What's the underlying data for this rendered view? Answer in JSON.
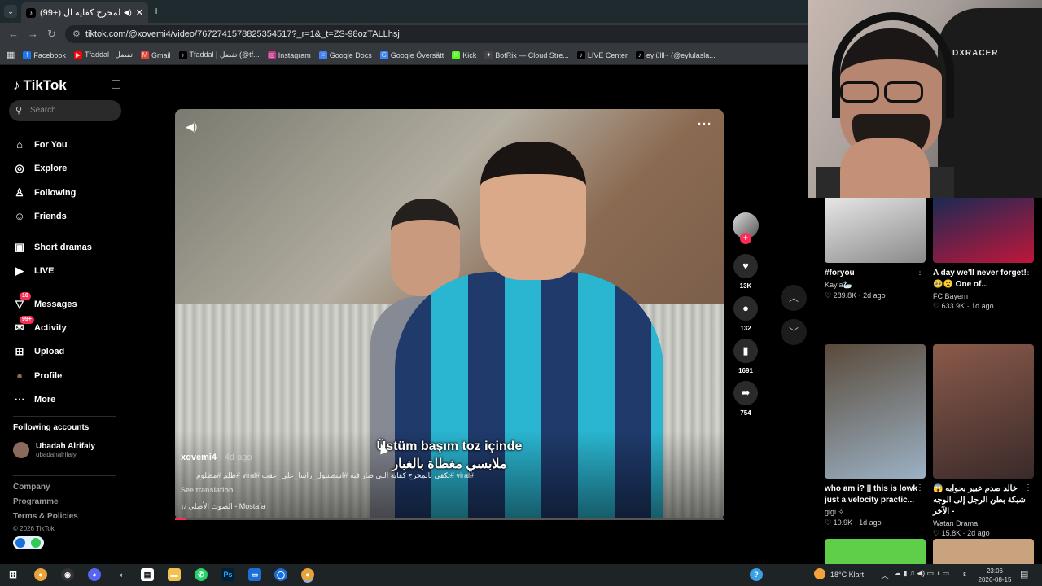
{
  "browser": {
    "tab_title": "(99+) تكفى بالمخرج كفايه ال...",
    "url_scheme_icon": "site-info-icon",
    "url": "tiktok.com/@xovemi4/video/7672741578825354517?_r=1&_t=ZS-98ozTALLhsj",
    "bookmarks": [
      {
        "label": "Facebook",
        "color": "#1877f2",
        "glyph": "f"
      },
      {
        "label": "Tfaddal | تفضل",
        "color": "#ff0000",
        "glyph": "▶"
      },
      {
        "label": "Gmail",
        "color": "#ea4335",
        "glyph": "M"
      },
      {
        "label": "Tfaddal | تفضل (@tf...",
        "color": "#000000",
        "glyph": "♪"
      },
      {
        "label": "Instagram",
        "color": "#c13584",
        "glyph": "◎"
      },
      {
        "label": "Google Docs",
        "color": "#4285f4",
        "glyph": "≡"
      },
      {
        "label": "Google Översätt",
        "color": "#4285f4",
        "glyph": "G"
      },
      {
        "label": "Kick",
        "color": "#53fc18",
        "glyph": "K"
      },
      {
        "label": "BotRix — Cloud Stre...",
        "color": "#444444",
        "glyph": "✦"
      },
      {
        "label": "LIVE Center",
        "color": "#000000",
        "glyph": "♪"
      },
      {
        "label": "eylülll~ (@eylulasla...",
        "color": "#000000",
        "glyph": "♪"
      }
    ]
  },
  "sidebar": {
    "logo": "TikTok",
    "search_placeholder": "Search",
    "items": [
      {
        "label": "For You",
        "icon": "home-icon",
        "glyph": "⌂"
      },
      {
        "label": "Explore",
        "icon": "compass-icon",
        "glyph": "◎"
      },
      {
        "label": "Following",
        "icon": "following-icon",
        "glyph": "♙"
      },
      {
        "label": "Friends",
        "icon": "friends-icon",
        "glyph": "☺"
      },
      {
        "label": "Short dramas",
        "icon": "dramas-icon",
        "glyph": "▣"
      },
      {
        "label": "LIVE",
        "icon": "live-icon",
        "glyph": "▶"
      },
      {
        "label": "Messages",
        "icon": "messages-icon",
        "glyph": "▽",
        "badge": "10"
      },
      {
        "label": "Activity",
        "icon": "activity-icon",
        "glyph": "✉",
        "badge": "99+"
      },
      {
        "label": "Upload",
        "icon": "upload-icon",
        "glyph": "⊞"
      },
      {
        "label": "Profile",
        "icon": "profile-avatar-icon",
        "glyph": "●"
      },
      {
        "label": "More",
        "icon": "more-icon",
        "glyph": "⋯"
      }
    ],
    "following_accounts_title": "Following accounts",
    "following_account": {
      "name": "Ubadah Alrifaiy",
      "handle": "ubadahalrifaiy"
    },
    "footer": [
      "Company",
      "Programme",
      "Terms & Policies"
    ],
    "copyright": "© 2026 TikTok"
  },
  "video": {
    "author": "xovemi4",
    "age": "· 4d ago",
    "caption": "#viral #تكفى بالمخرج كفايه اللي صار فيه #اسطنبول_راسا_على_عقب #viral #ظلم #مظلوم",
    "see_translation": "See translation",
    "music": "الصوت الأصلي - Mostafa",
    "subtitle_line1": "Üstüm başım toz içinde",
    "subtitle_line2": "ملابسي مغطاة بالغبار",
    "progress": 0.02
  },
  "actions": {
    "likes": "13K",
    "comments": "132",
    "saves": "1691",
    "shares": "754"
  },
  "recommendations": [
    {
      "title": "#foryou",
      "author": "Kayla🦢",
      "likes": "289.8K",
      "age": "2d ago",
      "color1": "#e6e6e6",
      "color2": "#8a8a8a"
    },
    {
      "title": "A day we'll never forget! 🥹😮 One of...",
      "author": "FC Bayern",
      "likes": "633.9K",
      "age": "1d ago",
      "color1": "#1a2a55",
      "color2": "#c0163a"
    },
    {
      "title": "who am i? || this is lowk just a velocity practic...",
      "author": "gigi ✧",
      "likes": "10.9K",
      "age": "1d ago",
      "color1": "#5a4a3a",
      "color2": "#9bb1c4"
    },
    {
      "title": "خالد صدم عبير بجوابه 😱 شبكة بطن الرجل إلى الوجه الآخر -",
      "author": "Watan Drama",
      "likes": "15.8K",
      "age": "2d ago",
      "color1": "#8a5a4a",
      "color2": "#3a2a2a"
    }
  ],
  "webcam": {
    "chair_label": "DXRACER"
  },
  "taskbar": {
    "weather": "18°C  Klart",
    "time": "23:06",
    "date": "2026-08-15"
  }
}
